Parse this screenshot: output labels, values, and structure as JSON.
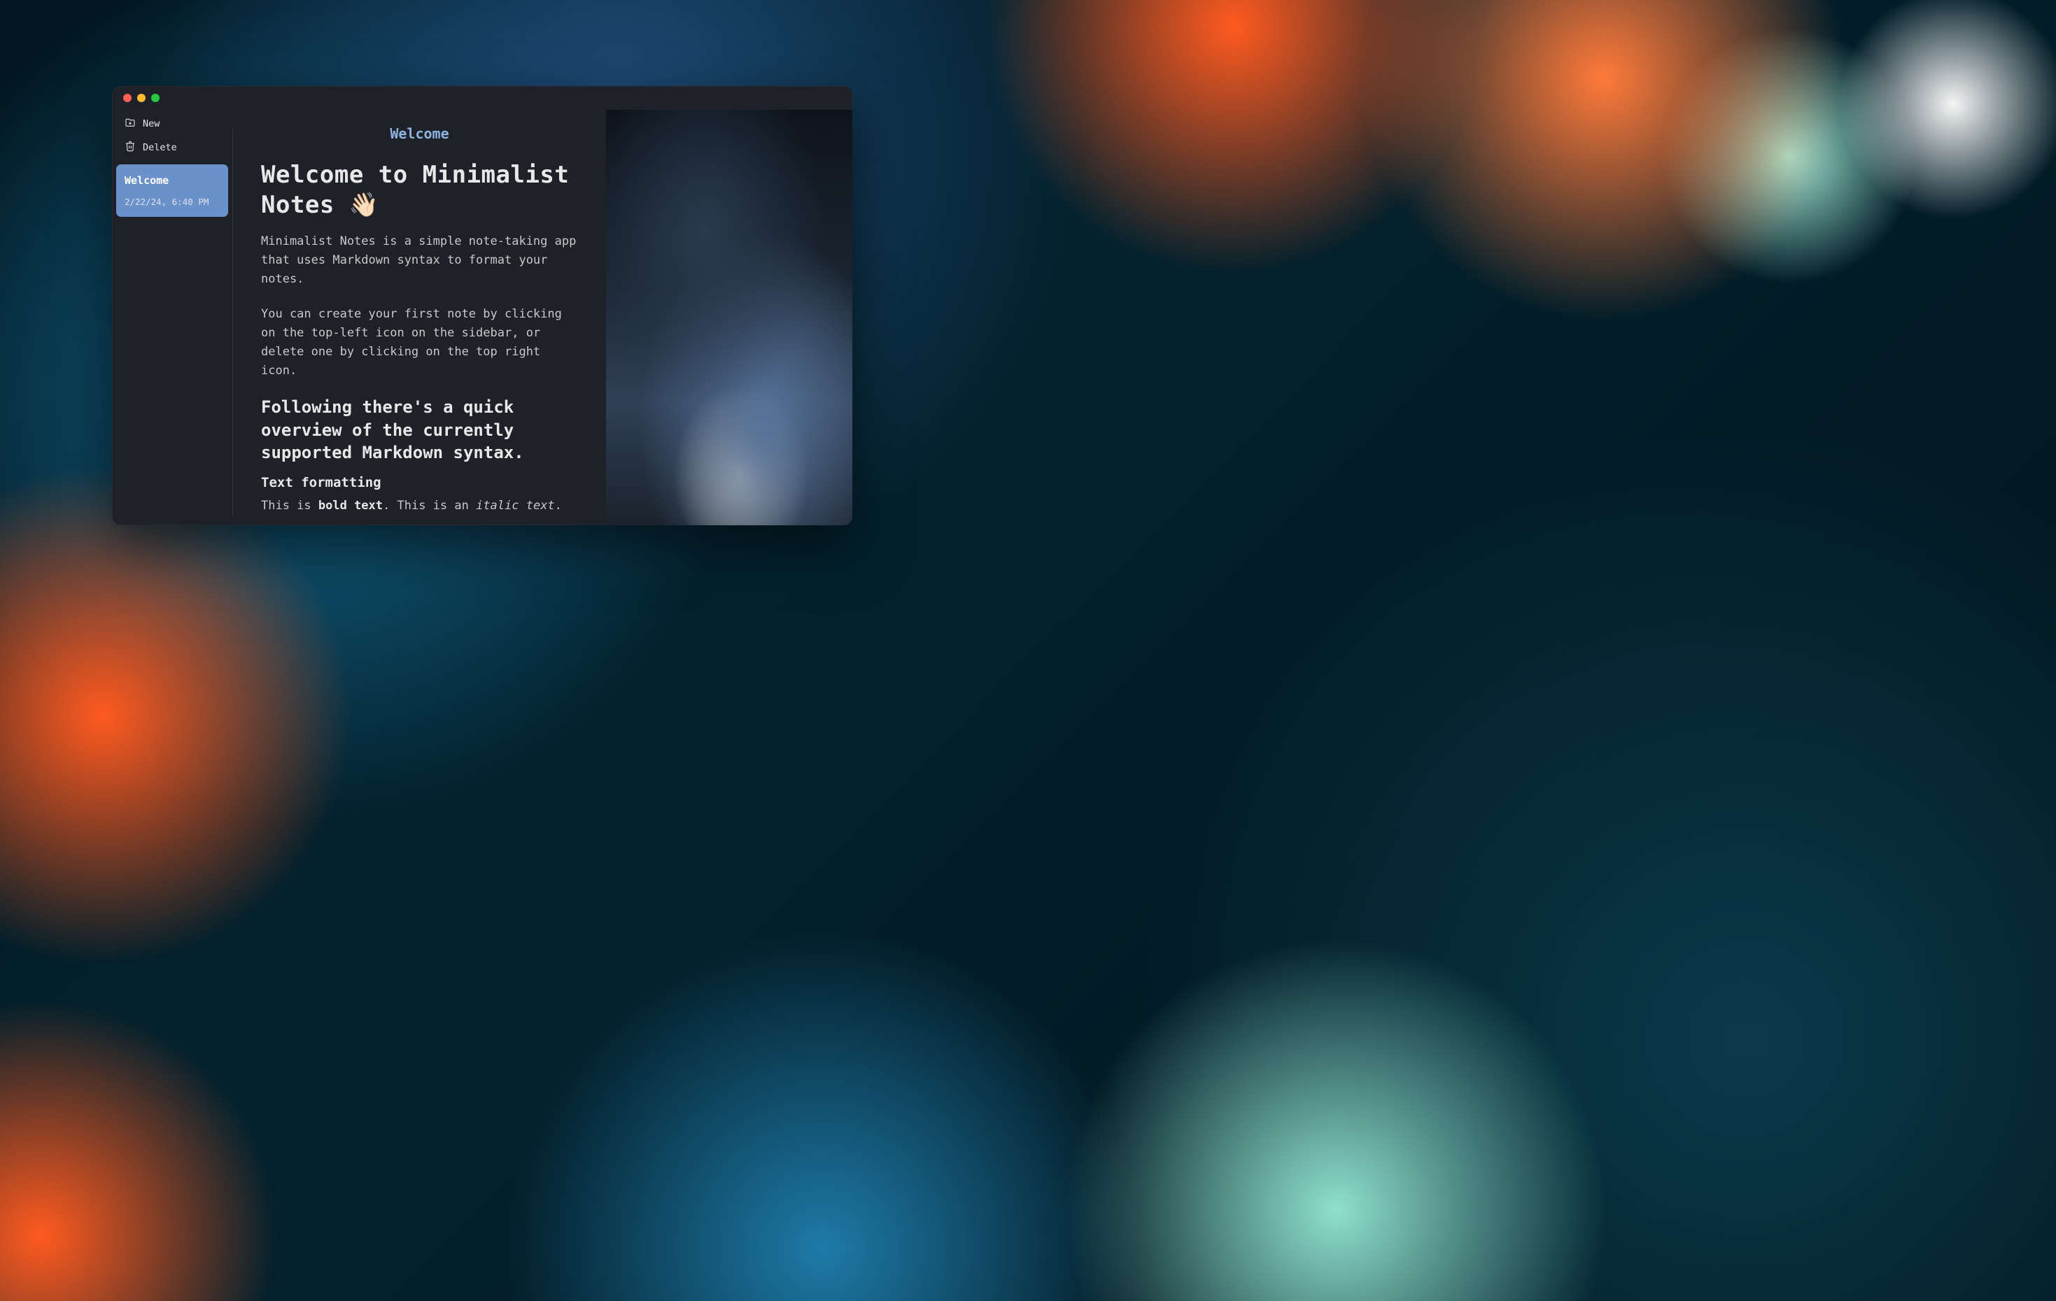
{
  "sidebar": {
    "new_label": "New",
    "delete_label": "Delete",
    "notes": [
      {
        "title": "Welcome",
        "date": "2/22/24, 6:40 PM"
      }
    ]
  },
  "editor": {
    "doc_title": "Welcome",
    "h1": "Welcome to Minimalist Notes 👋🏻",
    "p1": "Minimalist Notes is a simple note-taking app that uses Markdown syntax to format your notes.",
    "p2": "You can create your first note by clicking on the top-left icon on the sidebar, or delete one by clicking on the top right icon.",
    "h2": "Following there's a quick overview of the currently supported Markdown syntax.",
    "h3": "Text formatting",
    "cutoff_prefix": "This is ",
    "cutoff_bold": "bold text",
    "cutoff_mid": ". This is an ",
    "cutoff_italic": "italic text",
    "cutoff_suffix": "."
  },
  "colors": {
    "accent": "#6a91c9",
    "title": "#8fb3df"
  }
}
